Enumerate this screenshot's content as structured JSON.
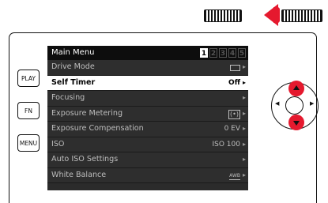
{
  "side_buttons": {
    "play": "PLAY",
    "fn": "FN",
    "menu": "MENU"
  },
  "screen": {
    "title": "Main Menu",
    "pages": [
      "1",
      "2",
      "3",
      "4",
      "5"
    ],
    "active_page": "1",
    "items": [
      {
        "label": "Drive Mode",
        "value": "",
        "icon": "single-frame-icon",
        "selected": false
      },
      {
        "label": "Self Timer",
        "value": "Off",
        "icon": "",
        "selected": true
      },
      {
        "label": "Focusing",
        "value": "",
        "icon": "",
        "selected": false
      },
      {
        "label": "Exposure Metering",
        "value": "",
        "icon": "metering-icon",
        "selected": false
      },
      {
        "label": "Exposure Compensation",
        "value": "0 EV",
        "icon": "",
        "selected": false
      },
      {
        "label": "ISO",
        "value": "ISO 100",
        "icon": "",
        "selected": false
      },
      {
        "label": "Auto ISO Settings",
        "value": "",
        "icon": "",
        "selected": false
      },
      {
        "label": "White Balance",
        "value": "AWB",
        "icon": "awb-icon",
        "selected": false
      }
    ]
  },
  "colors": {
    "accent_red": "#e5192e",
    "selected_row": "#ffffff",
    "screen_bg": "#2e2e2e",
    "header_bg": "#0d0d0d"
  }
}
